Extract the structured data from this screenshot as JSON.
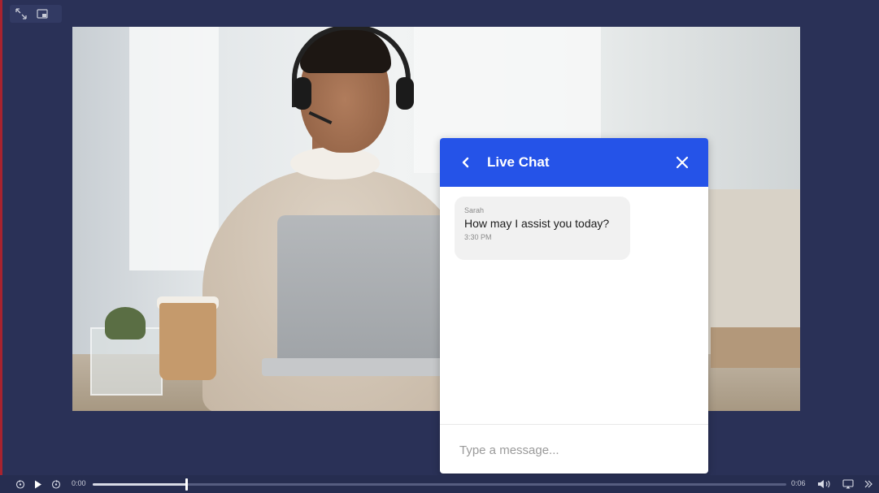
{
  "chat": {
    "title": "Live Chat",
    "message": {
      "sender": "Sarah",
      "text": "How may I assist you today?",
      "time": "3:30 PM"
    },
    "input_placeholder": "Type a message..."
  },
  "player": {
    "current_time": "0:00",
    "duration": "0:06",
    "progress_fraction": 0.135
  },
  "colors": {
    "accent": "#2553e8",
    "background": "#2a3157"
  },
  "icons": {
    "top_left": [
      "expand-icon",
      "picture-in-picture-icon"
    ],
    "controls_left": [
      "rewind-icon",
      "play-icon",
      "forward-icon"
    ],
    "controls_right": [
      "volume-icon",
      "airplay-icon",
      "next-icon"
    ],
    "chat": [
      "back-chevron-icon",
      "close-icon"
    ]
  }
}
